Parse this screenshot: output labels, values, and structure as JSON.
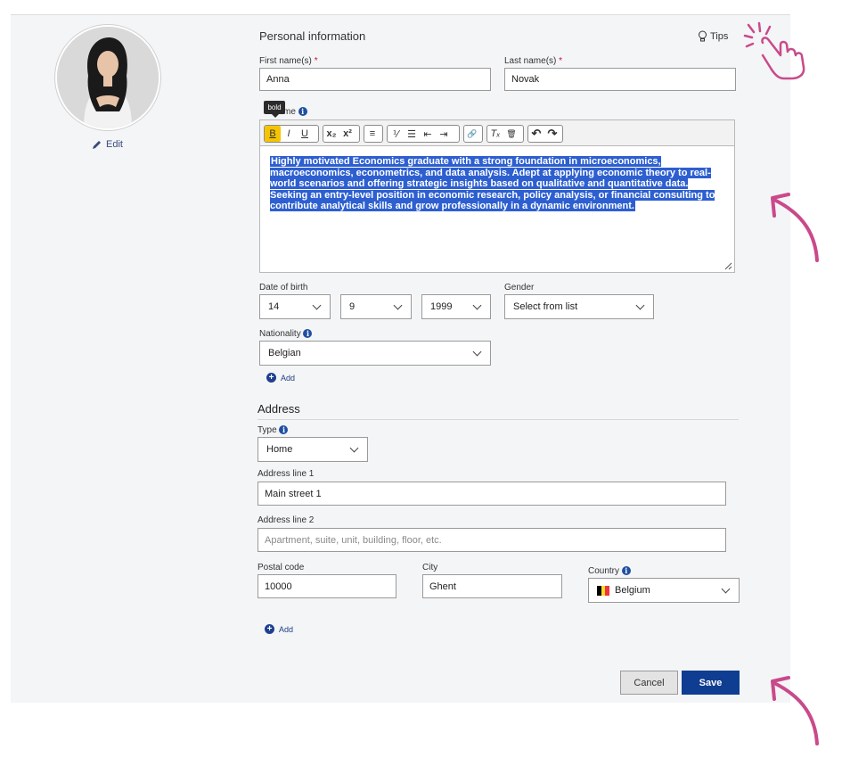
{
  "profile": {
    "edit_label": "Edit"
  },
  "personal": {
    "title": "Personal information",
    "tips_label": "Tips",
    "first_name": {
      "label": "First name(s)",
      "required": "*",
      "value": "Anna"
    },
    "last_name": {
      "label": "Last name(s)",
      "required": "*",
      "value": "Novak"
    },
    "about_label_visible": "me",
    "tooltip": "bold",
    "toolbar": {
      "bold": "B",
      "italic": "I",
      "underline": "U",
      "subscript": "x₂",
      "superscript": "x²",
      "align": "≡",
      "ordered_list": "⅟",
      "bullet_list": "☰",
      "outdent": "⇤",
      "indent": "⇥",
      "link": "🔗",
      "clear_format": "Tₓ",
      "delete": "🗑",
      "undo": "↶",
      "redo": "↷"
    },
    "about_text": "Highly motivated Economics graduate with a strong foundation in microeconomics, macroeconomics, econometrics, and data analysis. Adept at applying economic theory to real-world scenarios and offering strategic insights based on qualitative and quantitative data. Seeking an entry-level position in economic research, policy analysis, or financial consulting to contribute analytical skills and grow professionally in a dynamic environment.",
    "dob": {
      "label": "Date of birth",
      "day": "14",
      "month": "9",
      "year": "1999"
    },
    "gender": {
      "label": "Gender",
      "value": "Select from list"
    },
    "nationality": {
      "label": "Nationality",
      "value": "Belgian"
    },
    "add_label": "Add"
  },
  "address": {
    "title": "Address",
    "type": {
      "label": "Type",
      "value": "Home"
    },
    "line1": {
      "label": "Address line 1",
      "value": "Main street 1"
    },
    "line2": {
      "label": "Address line 2",
      "placeholder": "Apartment, suite, unit, building, floor, etc."
    },
    "postal": {
      "label": "Postal code",
      "value": "10000"
    },
    "city": {
      "label": "City",
      "value": "Ghent"
    },
    "country": {
      "label": "Country",
      "value": "Belgium"
    },
    "add_label": "Add"
  },
  "actions": {
    "cancel": "Cancel",
    "save": "Save"
  },
  "colors": {
    "accent": "#0f3d91",
    "highlight": "#2d5fd0",
    "arrow": "#c94a8a",
    "bold_active": "#f5c400"
  }
}
